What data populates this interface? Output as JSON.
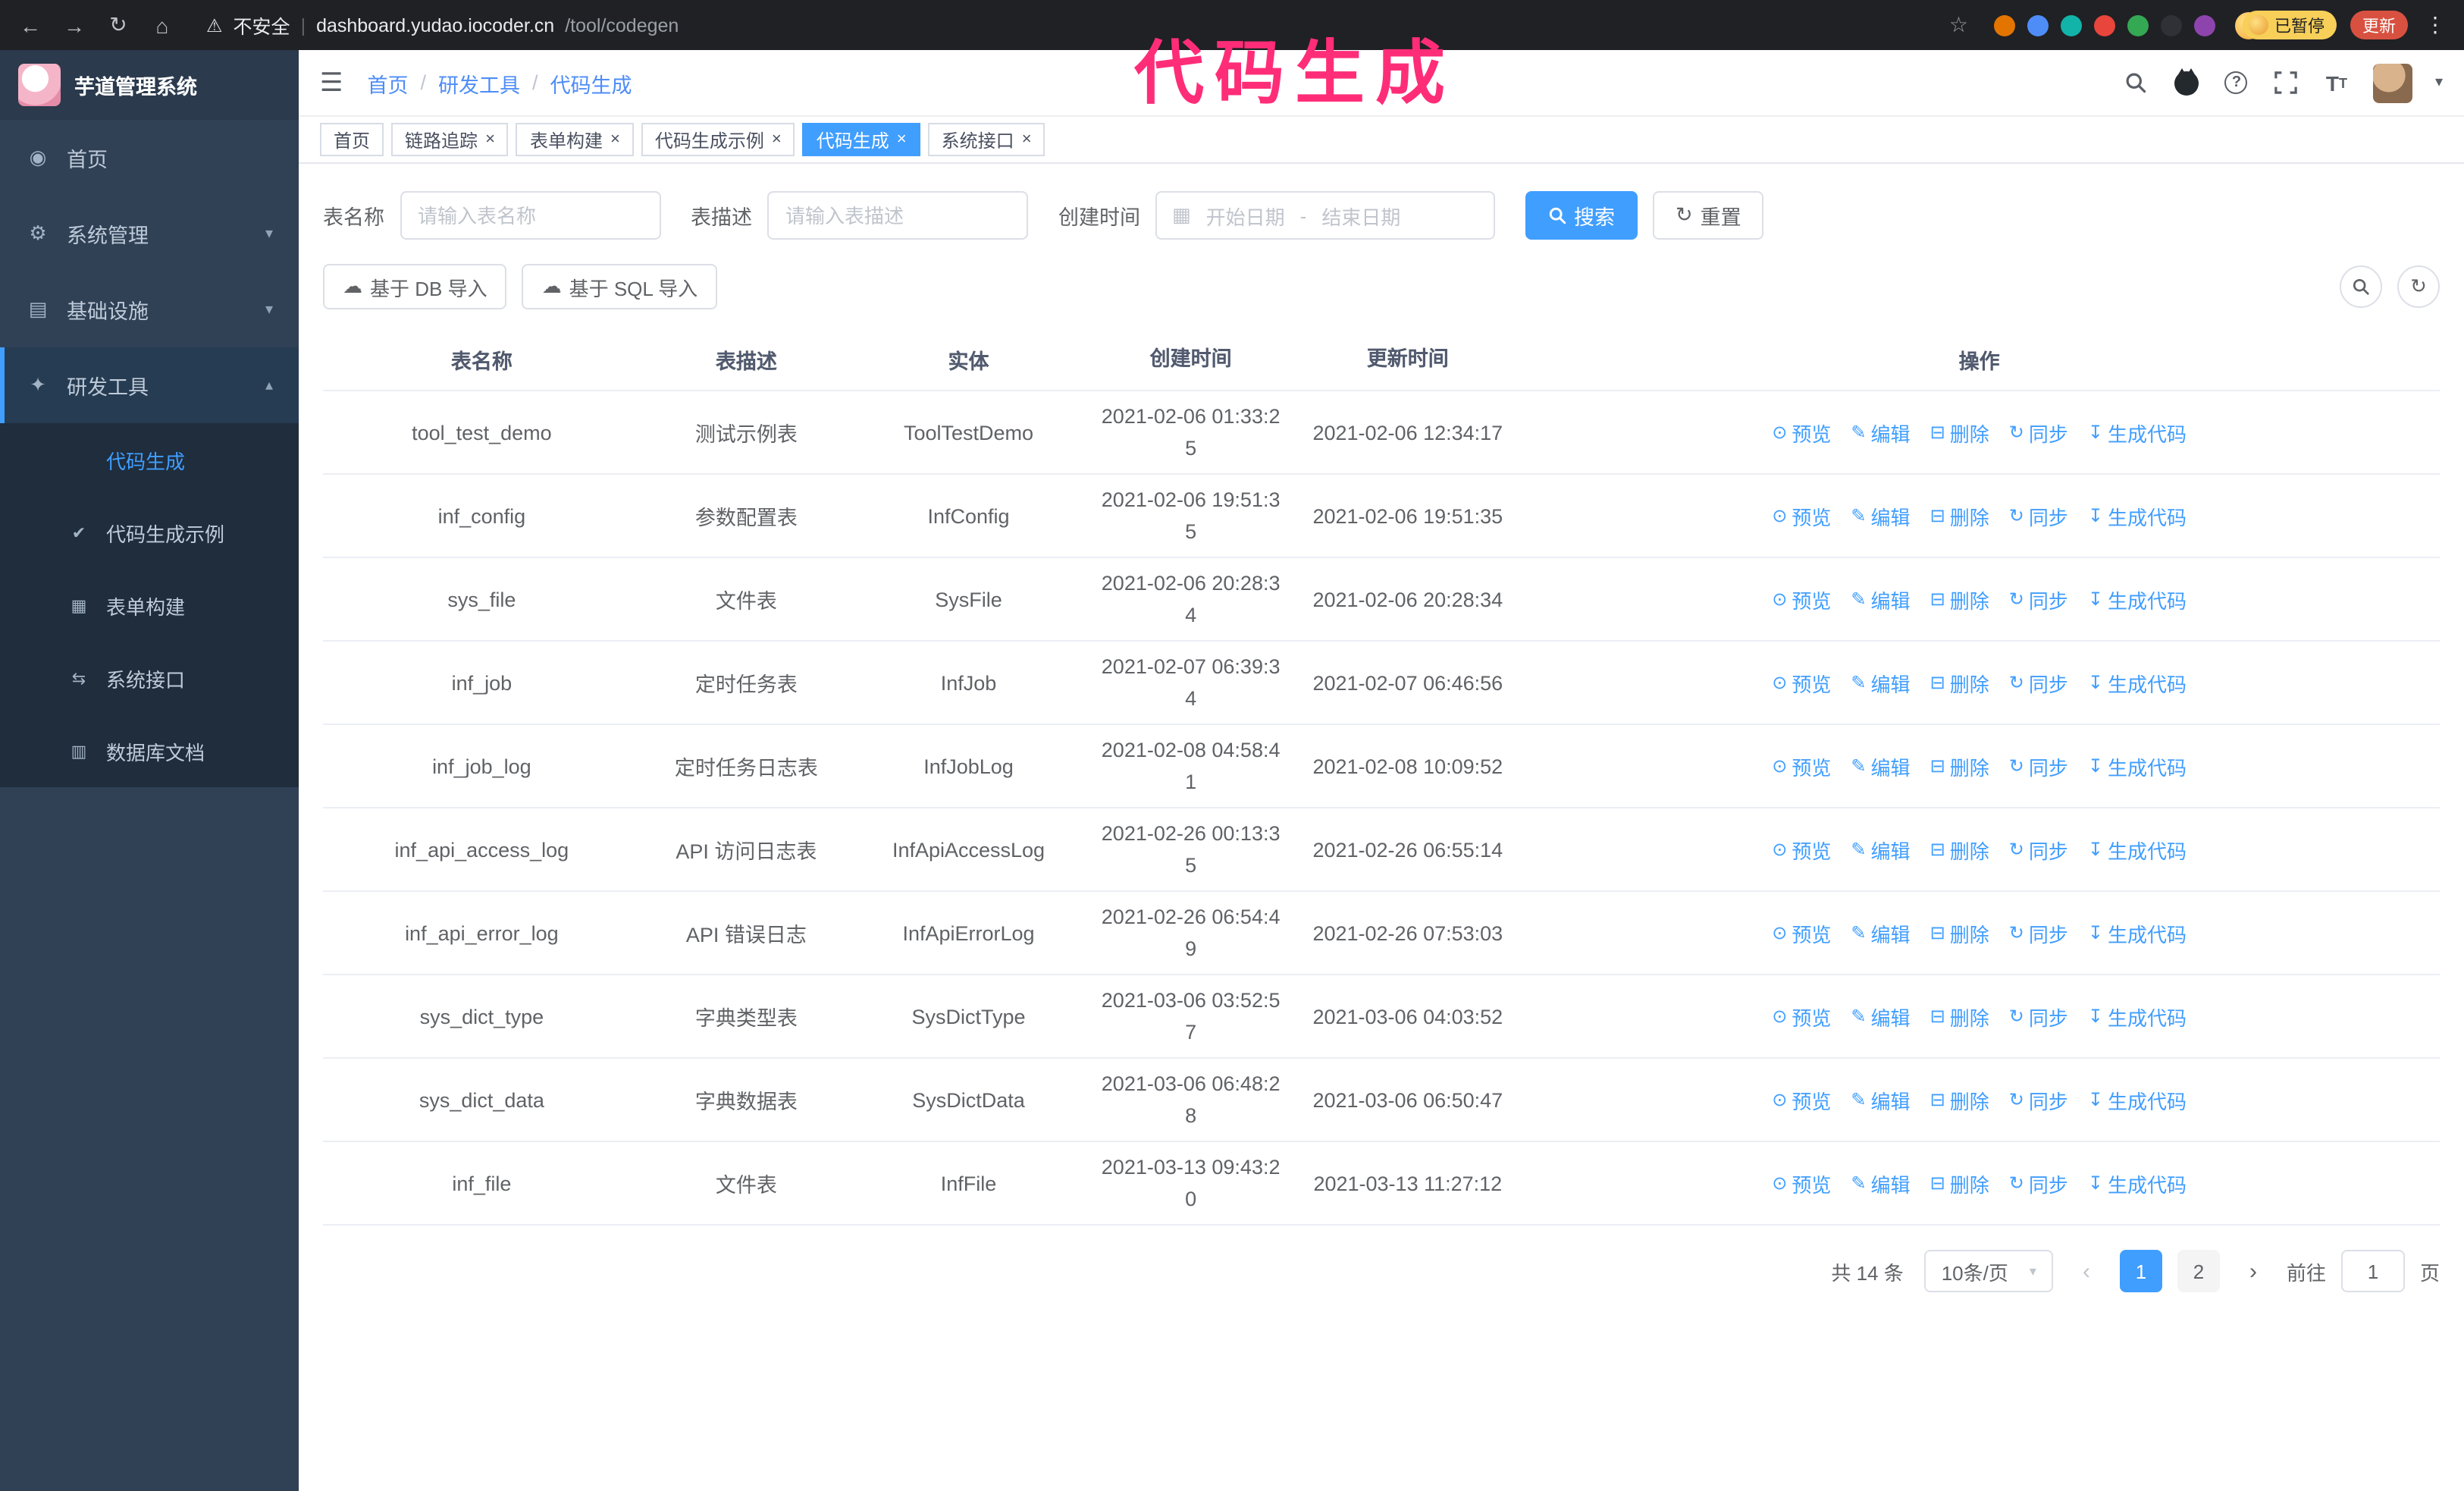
{
  "colors": {
    "accent": "#409eff",
    "annotation": "#ff2d78",
    "update_button": "#d85140",
    "paused_badge": "#f7cf59",
    "sidebar_bg": "#304156",
    "submenu_bg": "#1f2d3d"
  },
  "annotation": {
    "text": "代码生成"
  },
  "browser": {
    "security_warning": "不安全",
    "url_host": "dashboard.yudao.iocoder.cn",
    "url_path": "/tool/codegen",
    "paused_badge": "已暂停",
    "update_button": "更新",
    "extension_colors": [
      "#e37400",
      "#4e8df7",
      "#12b3a8",
      "#e8453c",
      "#34a853",
      "#2f3136",
      "#8e44ad"
    ]
  },
  "sidebar": {
    "logo_title": "芋道管理系统",
    "items": [
      {
        "label": "首页",
        "icon": "home",
        "caret": ""
      },
      {
        "label": "系统管理",
        "icon": "system",
        "caret": "down"
      },
      {
        "label": "基础设施",
        "icon": "infra",
        "caret": "down"
      },
      {
        "label": "研发工具",
        "icon": "tools",
        "caret": "up",
        "expanded": true
      }
    ],
    "subitems": [
      {
        "label": "代码生成",
        "icon": "code",
        "active": true
      },
      {
        "label": "代码生成示例",
        "icon": "example"
      },
      {
        "label": "表单构建",
        "icon": "form"
      },
      {
        "label": "系统接口",
        "icon": "api"
      },
      {
        "label": "数据库文档",
        "icon": "db"
      }
    ]
  },
  "header": {
    "breadcrumb": [
      "首页",
      "研发工具",
      "代码生成"
    ]
  },
  "tabs": [
    {
      "label": "首页",
      "closable": false,
      "active": false
    },
    {
      "label": "链路追踪",
      "closable": true,
      "active": false
    },
    {
      "label": "表单构建",
      "closable": true,
      "active": false
    },
    {
      "label": "代码生成示例",
      "closable": true,
      "active": false
    },
    {
      "label": "代码生成",
      "closable": true,
      "active": true
    },
    {
      "label": "系统接口",
      "closable": true,
      "active": false
    }
  ],
  "filters": {
    "table_name_label": "表名称",
    "table_name_placeholder": "请输入表名称",
    "table_desc_label": "表描述",
    "table_desc_placeholder": "请输入表描述",
    "create_time_label": "创建时间",
    "date_start_placeholder": "开始日期",
    "date_separator": "-",
    "date_end_placeholder": "结束日期",
    "search_button": "搜索",
    "reset_button": "重置"
  },
  "toolbar": {
    "import_db": "基于 DB 导入",
    "import_sql": "基于 SQL 导入"
  },
  "table": {
    "columns": [
      "表名称",
      "表描述",
      "实体",
      "创建时间",
      "更新时间",
      "操作"
    ],
    "actions": [
      {
        "label": "预览",
        "icon": "eye"
      },
      {
        "label": "编辑",
        "icon": "edit"
      },
      {
        "label": "删除",
        "icon": "delete"
      },
      {
        "label": "同步",
        "icon": "sync"
      },
      {
        "label": "生成代码",
        "icon": "download"
      }
    ],
    "rows": [
      [
        "tool_test_demo",
        "测试示例表",
        "ToolTestDemo",
        "2021-02-06 01:33:25",
        "2021-02-06 12:34:17"
      ],
      [
        "inf_config",
        "参数配置表",
        "InfConfig",
        "2021-02-06 19:51:35",
        "2021-02-06 19:51:35"
      ],
      [
        "sys_file",
        "文件表",
        "SysFile",
        "2021-02-06 20:28:34",
        "2021-02-06 20:28:34"
      ],
      [
        "inf_job",
        "定时任务表",
        "InfJob",
        "2021-02-07 06:39:34",
        "2021-02-07 06:46:56"
      ],
      [
        "inf_job_log",
        "定时任务日志表",
        "InfJobLog",
        "2021-02-08 04:58:41",
        "2021-02-08 10:09:52"
      ],
      [
        "inf_api_access_log",
        "API 访问日志表",
        "InfApiAccessLog",
        "2021-02-26 00:13:35",
        "2021-02-26 06:55:14"
      ],
      [
        "inf_api_error_log",
        "API 错误日志",
        "InfApiErrorLog",
        "2021-02-26 06:54:49",
        "2021-02-26 07:53:03"
      ],
      [
        "sys_dict_type",
        "字典类型表",
        "SysDictType",
        "2021-03-06 03:52:57",
        "2021-03-06 04:03:52"
      ],
      [
        "sys_dict_data",
        "字典数据表",
        "SysDictData",
        "2021-03-06 06:48:28",
        "2021-03-06 06:50:47"
      ],
      [
        "inf_file",
        "文件表",
        "InfFile",
        "2021-03-13 09:43:20",
        "2021-03-13 11:27:12"
      ]
    ]
  },
  "pagination": {
    "total": "共 14 条",
    "page_size": "10条/页",
    "pages": [
      "1",
      "2"
    ],
    "active_page": "1",
    "prev_icon": "‹",
    "next_icon": "›",
    "goto_label": "前往",
    "goto_value": "1",
    "goto_suffix": "页"
  }
}
